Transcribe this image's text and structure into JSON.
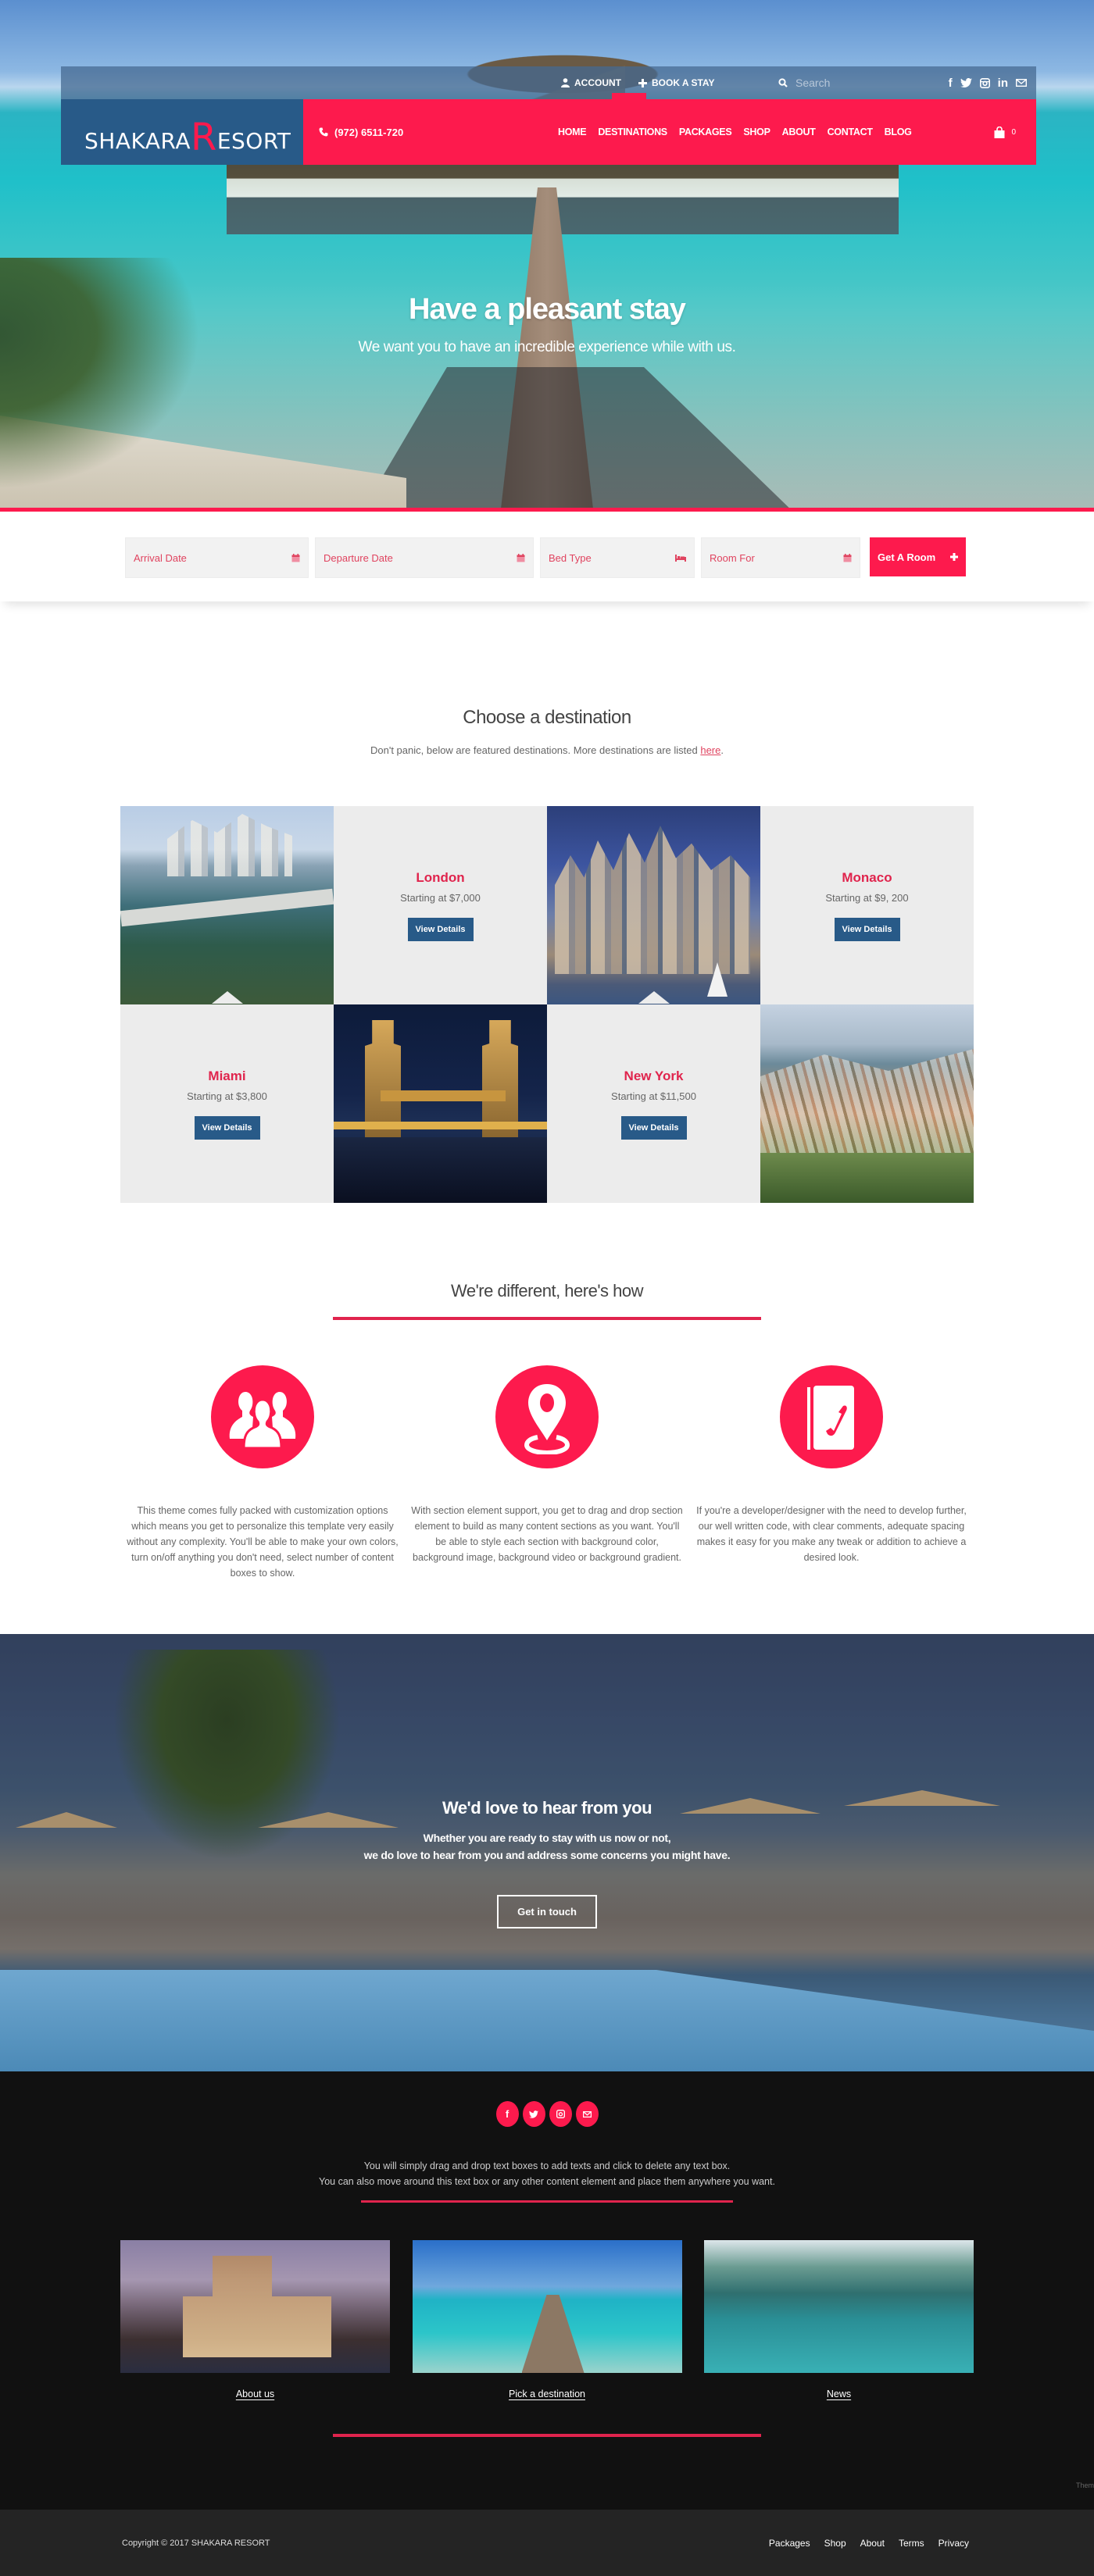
{
  "topbar": {
    "account": "Account",
    "book_a_stay": "Book A Stay",
    "search_placeholder": "Search",
    "social": [
      "facebook",
      "twitter",
      "instagram",
      "linkedin",
      "email"
    ]
  },
  "brand": {
    "logo_prefix": "SHAKARA",
    "logo_big_letter": "R",
    "logo_suffix": "ESORT",
    "primary_color": "#fd1a4d",
    "secondary_color": "#285a88"
  },
  "navbar": {
    "phone": "(972) 6511-720",
    "menu": [
      "Home",
      "Destinations",
      "Packages",
      "Shop",
      "About",
      "Contact",
      "Blog"
    ],
    "cart_count": "0"
  },
  "hero": {
    "title": "Have a pleasant stay",
    "subtitle": "We want you to have an incredible experience while with us."
  },
  "booking": {
    "arrival_placeholder": "Arrival Date",
    "departure_placeholder": "Departure Date",
    "bed_type_placeholder": "Bed Type",
    "room_for_placeholder": "Room For",
    "submit_label": "Get A Room"
  },
  "destinations": {
    "title": "Choose a destination",
    "subtitle_prefix": "Don't panic, below are featured destinations. More destinations are listed ",
    "subtitle_link": "here",
    "subtitle_suffix": ".",
    "button_label": "View Details",
    "items": [
      {
        "city": "London",
        "price": "Starting at $7,000"
      },
      {
        "city": "Monaco",
        "price": "Starting at $9, 200"
      },
      {
        "city": "Miami",
        "price": "Starting at $3,800"
      },
      {
        "city": "New York",
        "price": "Starting at $11,500"
      }
    ]
  },
  "features": {
    "title": "We're different, here's how",
    "items": [
      {
        "icon": "users-icon",
        "text": "This theme comes fully packed with customization options which means you get to personalize this template very easily without any complexity. You'll be able to make your own colors, turn on/off anything you don't need, select number of content boxes to show."
      },
      {
        "icon": "map-pin-icon",
        "text": "With section element support, you get to drag and drop section element to build as many content sections as you want. You'll be able to style each section with background color, background image, background video or background gradient."
      },
      {
        "icon": "phone-book-icon",
        "text": "If you're a developer/designer with the need to develop further, our well written code, with clear comments, adequate spacing makes it easy for you make any tweak or addition to achieve a desired look."
      }
    ]
  },
  "contact": {
    "title": "We'd love to hear from you",
    "line1": "Whether you are ready to stay with us now or not,",
    "line2": "we do love to hear from you and address some concerns you might have.",
    "button_label": "Get in touch"
  },
  "footer": {
    "social": [
      "facebook",
      "twitter",
      "instagram",
      "email"
    ],
    "text_line1": "You will simply drag and drop text boxes to add texts and click to delete any text box.",
    "text_line2": "You can also move around this text box or any other content element and place them anywhere you want.",
    "cards": [
      {
        "label": "About us"
      },
      {
        "label": "Pick a destination"
      },
      {
        "label": "News"
      }
    ],
    "theme_mark": "Them",
    "copyright": "Copyright © 2017 SHAKARA RESORT",
    "links": [
      "Packages",
      "Shop",
      "About",
      "Terms",
      "Privacy"
    ]
  }
}
